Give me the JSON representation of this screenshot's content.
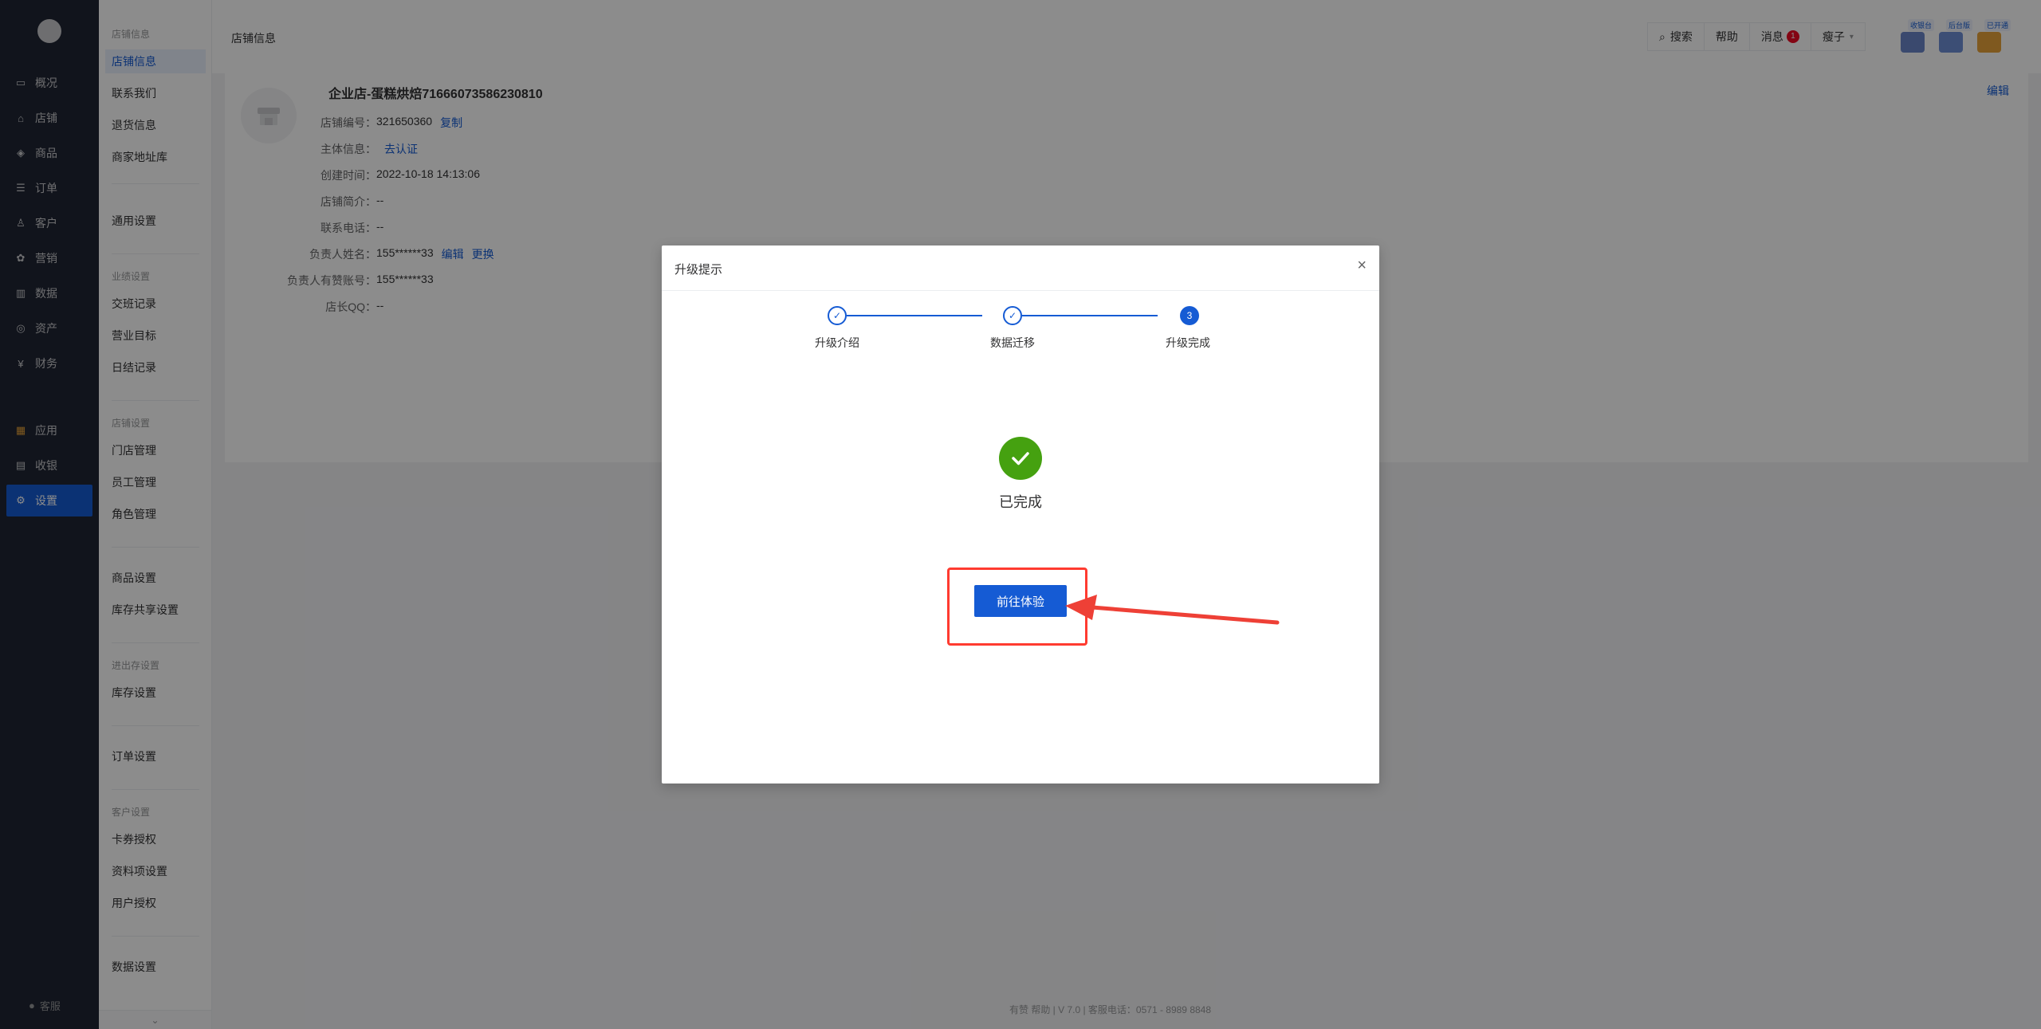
{
  "nav": {
    "items": [
      {
        "label": "概况",
        "icon": "dashboard-icon"
      },
      {
        "label": "店铺",
        "icon": "store-icon"
      },
      {
        "label": "商品",
        "icon": "goods-icon"
      },
      {
        "label": "订单",
        "icon": "order-icon"
      },
      {
        "label": "客户",
        "icon": "customer-icon"
      },
      {
        "label": "营销",
        "icon": "gift-icon"
      },
      {
        "label": "数据",
        "icon": "chart-icon"
      },
      {
        "label": "资产",
        "icon": "asset-icon"
      },
      {
        "label": "财务",
        "icon": "finance-icon"
      },
      {
        "label": "应用",
        "icon": "apps-icon"
      },
      {
        "label": "收银",
        "icon": "cashier-icon"
      },
      {
        "label": "设置",
        "icon": "gear-icon"
      }
    ],
    "active": "设置",
    "footer": "客服"
  },
  "submenu": {
    "groups": {
      "store_info": "店铺信息",
      "business": "业绩设置",
      "store_settings": "店铺设置",
      "inventory": "进出存设置",
      "customer": "客户设置"
    },
    "items": {
      "store_info": "店铺信息",
      "contact": "联系我们",
      "return_info": "退货信息",
      "address_lib": "商家地址库",
      "general": "通用设置",
      "shift": "交班记录",
      "target": "营业目标",
      "daily": "日结记录",
      "shop_manage": "门店管理",
      "staff": "员工管理",
      "role": "角色管理",
      "goods_settings": "商品设置",
      "stock_share": "库存共享设置",
      "stock_settings": "库存设置",
      "order_settings": "订单设置",
      "card_auth": "卡券授权",
      "profile_settings": "资料项设置",
      "user_auth": "用户授权",
      "data_settings": "数据设置"
    },
    "collapse": "⌄"
  },
  "topbar": {
    "title": "店铺信息",
    "search": "搜索",
    "help": "帮助",
    "messages": "消息",
    "message_count": "1",
    "user": "瘦子",
    "apps": [
      {
        "tag": "收银台",
        "color": "#6b85c9"
      },
      {
        "tag": "后台版",
        "color": "#6d8ed6"
      },
      {
        "tag": "已开通",
        "color": "#e8a33a"
      }
    ]
  },
  "store": {
    "name": "企业店-蛋糕烘焙71666073586230810",
    "edit": "编辑",
    "rows": [
      {
        "label": "店铺编号：",
        "value": "321650360",
        "links": [
          "复制"
        ]
      },
      {
        "label": "主体信息：",
        "value": "",
        "links": [
          "去认证"
        ]
      },
      {
        "label": "创建时间：",
        "value": "2022-10-18 14:13:06",
        "links": []
      },
      {
        "label": "店铺简介：",
        "value": "--",
        "links": []
      },
      {
        "label": "联系电话：",
        "value": "--",
        "links": []
      },
      {
        "label": "负责人姓名：",
        "value": "155******33",
        "links": [
          "编辑",
          "更换"
        ]
      },
      {
        "label": "负责人有赞账号：",
        "value": "155******33",
        "links": []
      },
      {
        "label": "店长QQ：",
        "value": "--",
        "links": []
      }
    ]
  },
  "footer": "有赞 帮助  |  V 7.0  |  客服电话：0571 - 8989 8848",
  "dialog": {
    "title": "升级提示",
    "close": "×",
    "steps": [
      {
        "label": "升级介绍",
        "state": "done"
      },
      {
        "label": "数据迁移",
        "state": "done"
      },
      {
        "label": "升级完成",
        "state": "current",
        "num": "3"
      }
    ],
    "result_text": "已完成",
    "button": "前往体验"
  }
}
